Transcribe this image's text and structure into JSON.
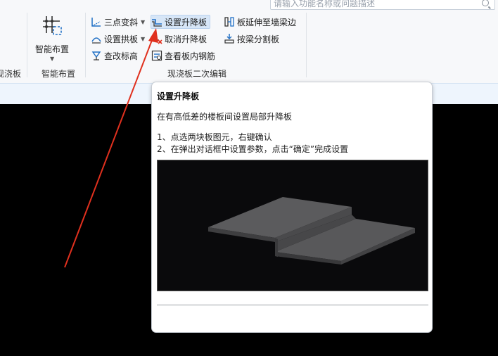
{
  "search": {
    "placeholder": "请输入功能名称或问题描述"
  },
  "ribbon": {
    "left_group_label": "现浇板",
    "smart_layout": {
      "label": "智能布置",
      "group_label": "智能布置"
    },
    "edit_group": {
      "label": "现浇板二次编辑",
      "tools": {
        "three_point_slope": "三点变斜",
        "set_step": "设置升降板",
        "extend_to_beam": "板延伸至墙梁边",
        "set_arch": "设置拱板",
        "cancel_step": "取消升降板",
        "split_by_beam": "按梁分割板",
        "edit_elevation": "查改标高",
        "view_rebar": "查看板内钢筋"
      }
    }
  },
  "tooltip": {
    "title": "设置升降板",
    "description": "在有高低差的楼板间设置局部升降板",
    "step1": "1、点选两块板图元，右键确认",
    "step2": "2、在弹出对话框中设置参数，点击“确定”完成设置"
  },
  "colors": {
    "accent": "#1f6fc5",
    "arrow": "#e0301e",
    "canvas": "#000000",
    "tooltip_bg": "#ffffff"
  },
  "icons": [
    "search-icon",
    "grid-layout-icon",
    "slope-icon",
    "step-slab-icon",
    "extend-slab-icon",
    "arch-icon",
    "cancel-step-icon",
    "split-icon",
    "elevation-icon",
    "rebar-view-icon"
  ]
}
